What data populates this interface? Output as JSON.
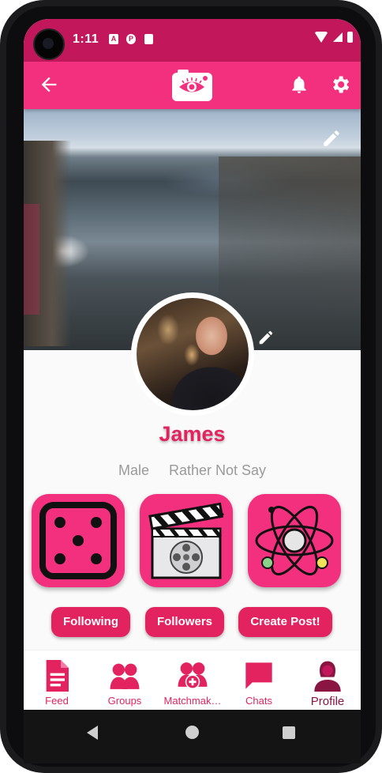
{
  "status_bar": {
    "time": "1:11",
    "icons": [
      "a-icon",
      "p-icon",
      "sd-card-icon"
    ]
  },
  "app_bar": {
    "back_icon": "arrow-left-icon",
    "logo_icon": "camera-eye-logo",
    "notifications_icon": "bell-icon",
    "settings_icon": "gear-icon"
  },
  "profile": {
    "name": "James",
    "gender": "Male",
    "orientation": "Rather Not Say",
    "cover_edit_icon": "pencil-icon",
    "avatar_edit_icon": "pencil-icon"
  },
  "interests": [
    {
      "icon": "dice-icon"
    },
    {
      "icon": "clapperboard-film-icon"
    },
    {
      "icon": "atom-icon"
    }
  ],
  "actions": {
    "following": "Following",
    "followers": "Followers",
    "create_post": "Create Post!"
  },
  "bottom_nav": [
    {
      "label": "Feed",
      "icon": "document-icon"
    },
    {
      "label": "Groups",
      "icon": "groups-icon"
    },
    {
      "label": "Matchmak…",
      "icon": "matchmaking-icon"
    },
    {
      "label": "Chats",
      "icon": "chat-bubble-icon"
    },
    {
      "label": "Profile",
      "icon": "profile-icon",
      "active": true
    }
  ],
  "colors": {
    "primary": "#f3307e",
    "status": "#c2185b",
    "accent_text": "#e3235f",
    "active_nav": "#8a1442"
  }
}
